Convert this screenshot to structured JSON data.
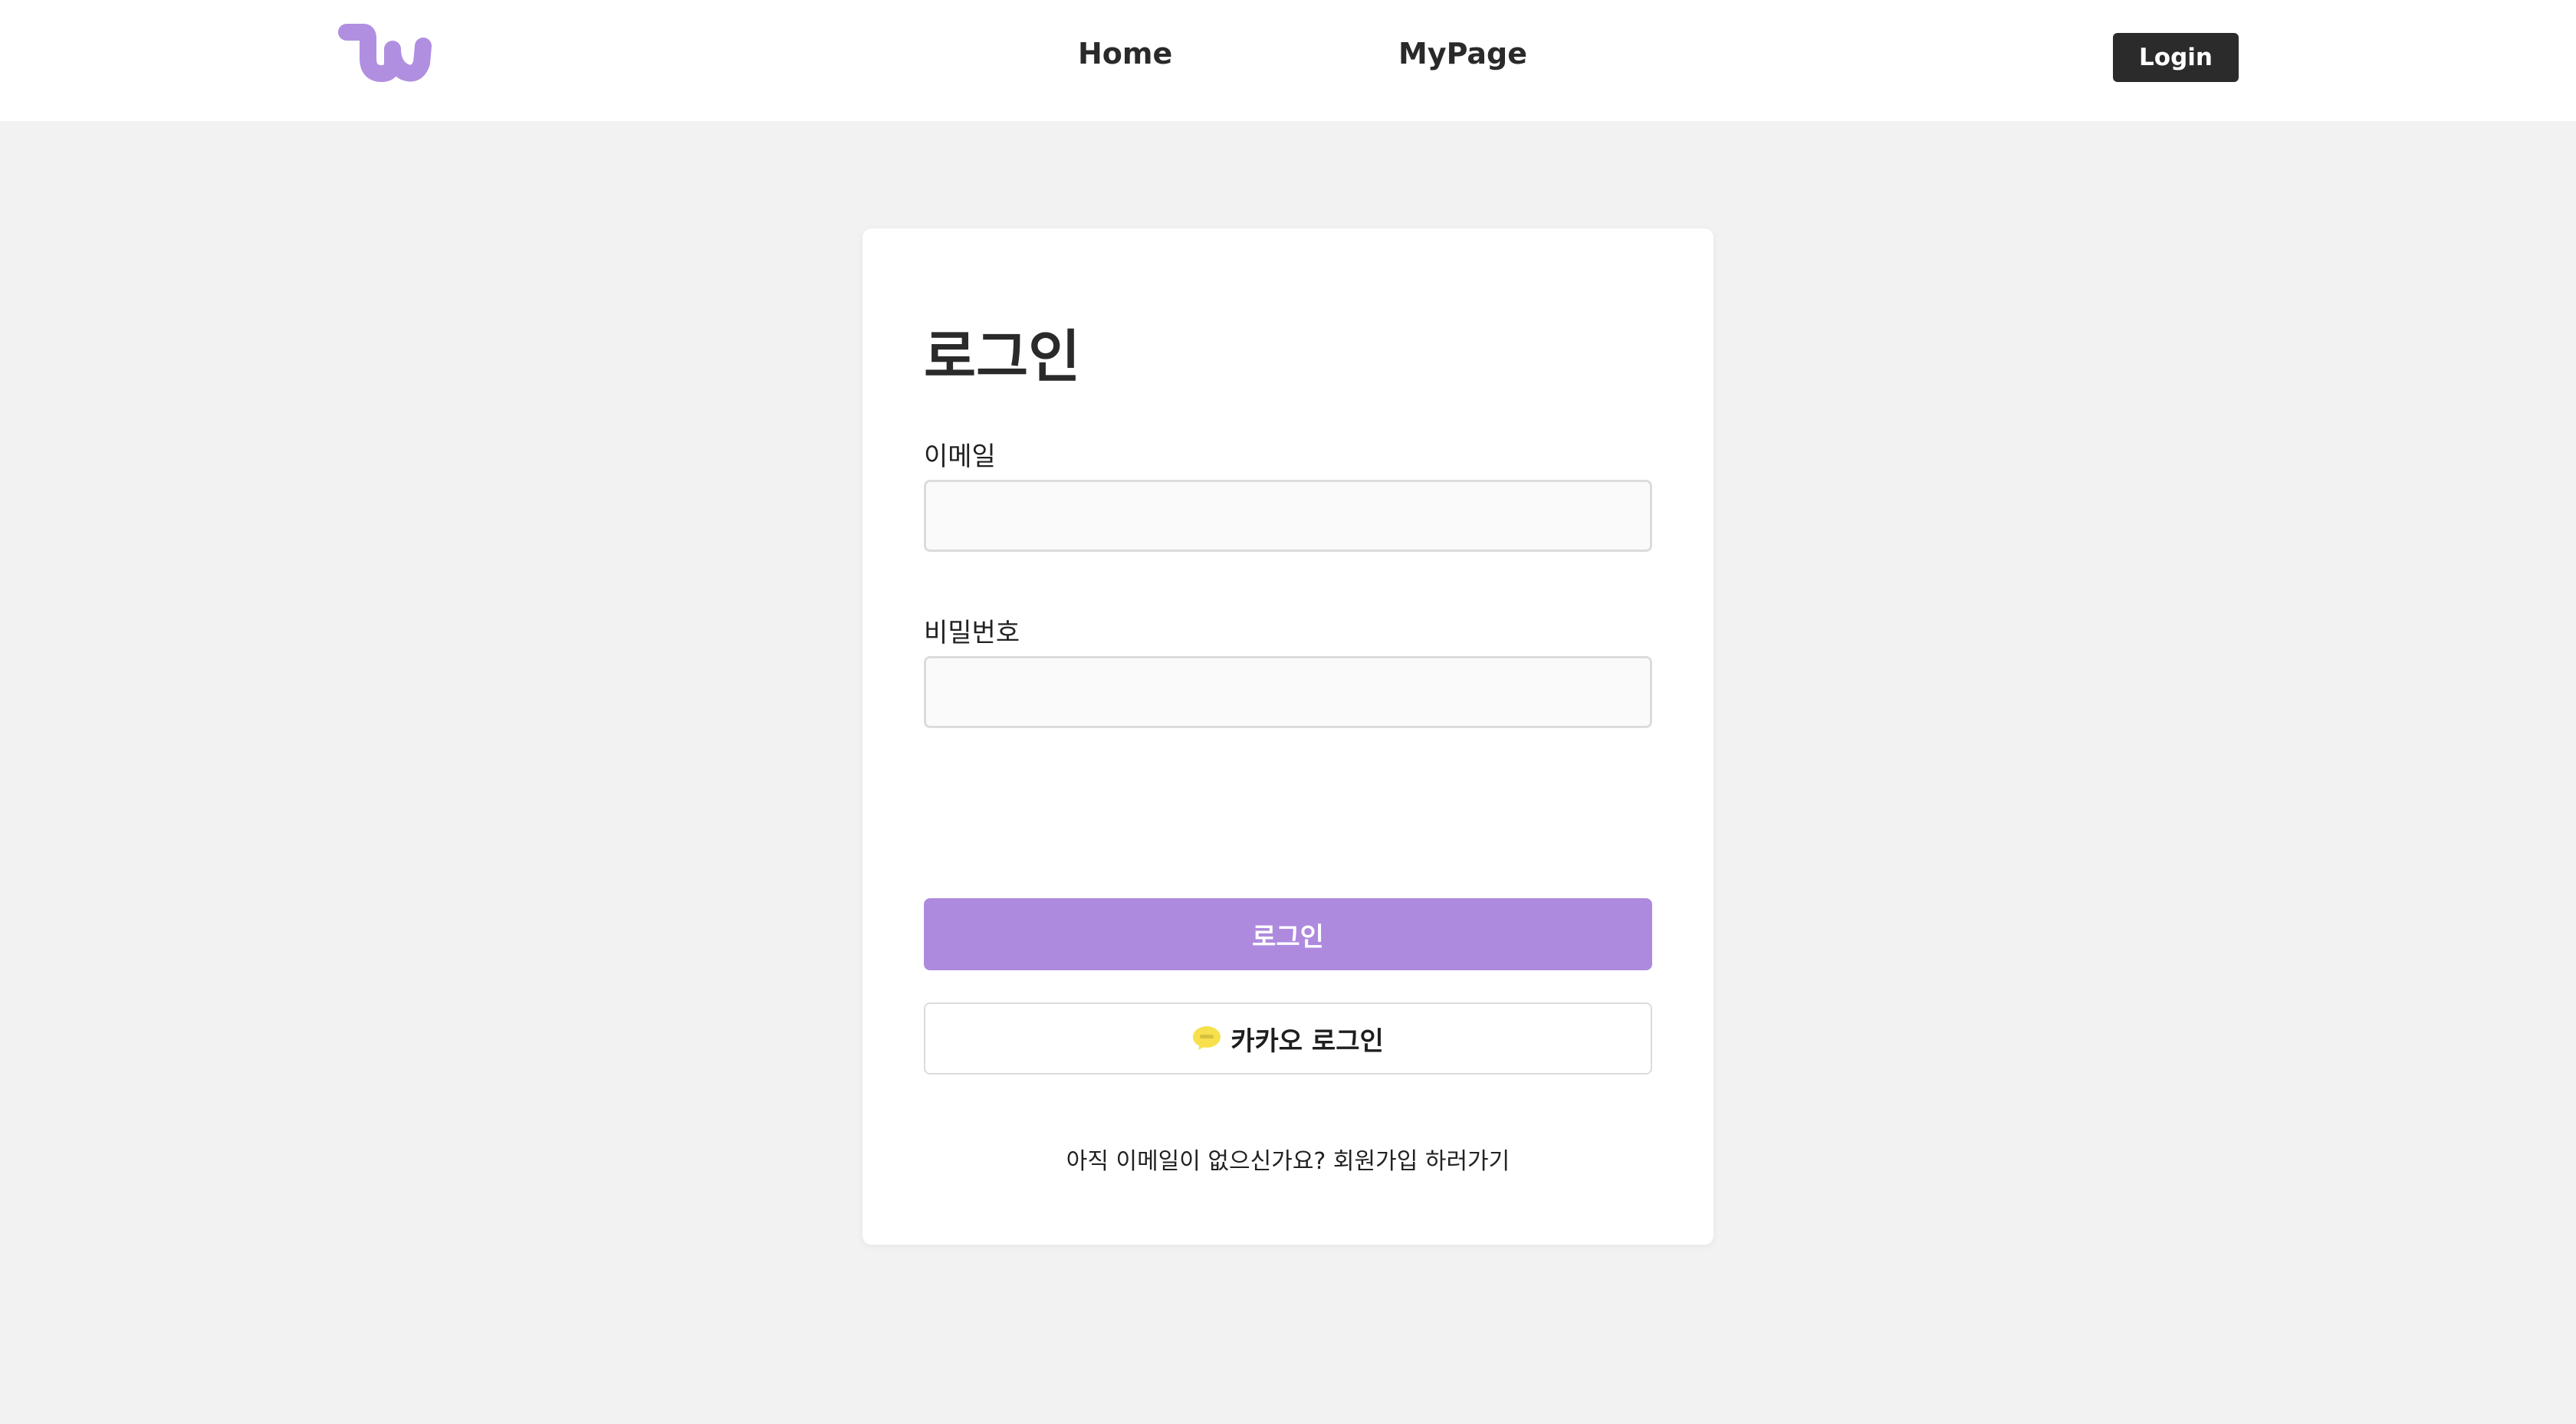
{
  "header": {
    "logo_icon": "w-logo-icon",
    "nav": [
      {
        "label": "Home"
      },
      {
        "label": "MyPage"
      }
    ],
    "login_label": "Login"
  },
  "login_form": {
    "title": "로그인",
    "email_label": "이메일",
    "email_value": "",
    "password_label": "비밀번호",
    "password_value": "",
    "submit_label": "로그인",
    "kakao_icon": "kakao-talk-icon",
    "kakao_label": "카카오 로그인",
    "signup_prompt": "아직 이메일이 없으신가요?",
    "signup_link": "회원가입 하러가기"
  },
  "colors": {
    "accent": "#ad8ade",
    "logo": "#b08fe0",
    "dark_button": "#2b2b2b",
    "kakao_yellow": "#f7e04b",
    "background": "#f2f2f2"
  }
}
